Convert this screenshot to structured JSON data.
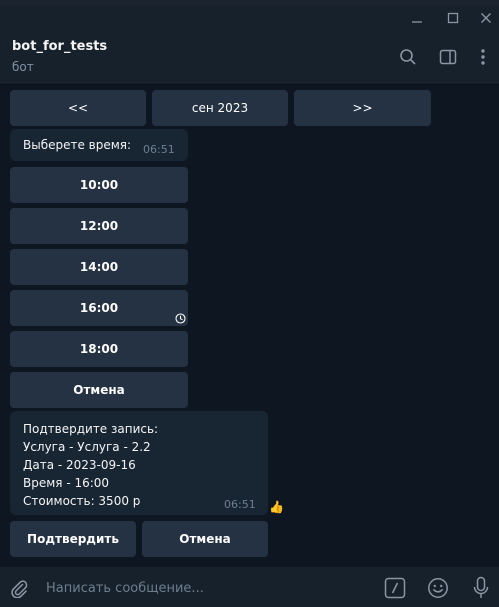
{
  "window": {
    "minimize_icon": "minimize-icon",
    "maximize_icon": "maximize-icon",
    "close_icon": "close-icon"
  },
  "header": {
    "title": "bot_for_tests",
    "subtitle": "бот",
    "icons": [
      "search-icon",
      "sidebar-toggle-icon",
      "more-vertical-icon"
    ]
  },
  "calendar_nav": {
    "prev_label": "<<",
    "month_label": "сен 2023",
    "next_label": ">>"
  },
  "time_message": {
    "text": "Выберете время:",
    "time": "06:51"
  },
  "time_slots": [
    "10:00",
    "12:00",
    "14:00",
    "16:00",
    "18:00"
  ],
  "cancel_label": "Отмена",
  "confirm_message": {
    "lines": [
      "Подтвердите запись:",
      "Услуга - Услуга - 2.2",
      "Дата - 2023-09-16",
      "Время - 16:00",
      "Стоимость: 3500 р"
    ],
    "time": "06:51",
    "reaction": "👍"
  },
  "confirm_buttons": {
    "confirm_label": "Подтвердить",
    "cancel_label": "Отмена"
  },
  "composer": {
    "placeholder": "Написать сообщение...",
    "icons": [
      "attach-icon",
      "commands-icon",
      "emoji-icon",
      "microphone-icon"
    ]
  }
}
